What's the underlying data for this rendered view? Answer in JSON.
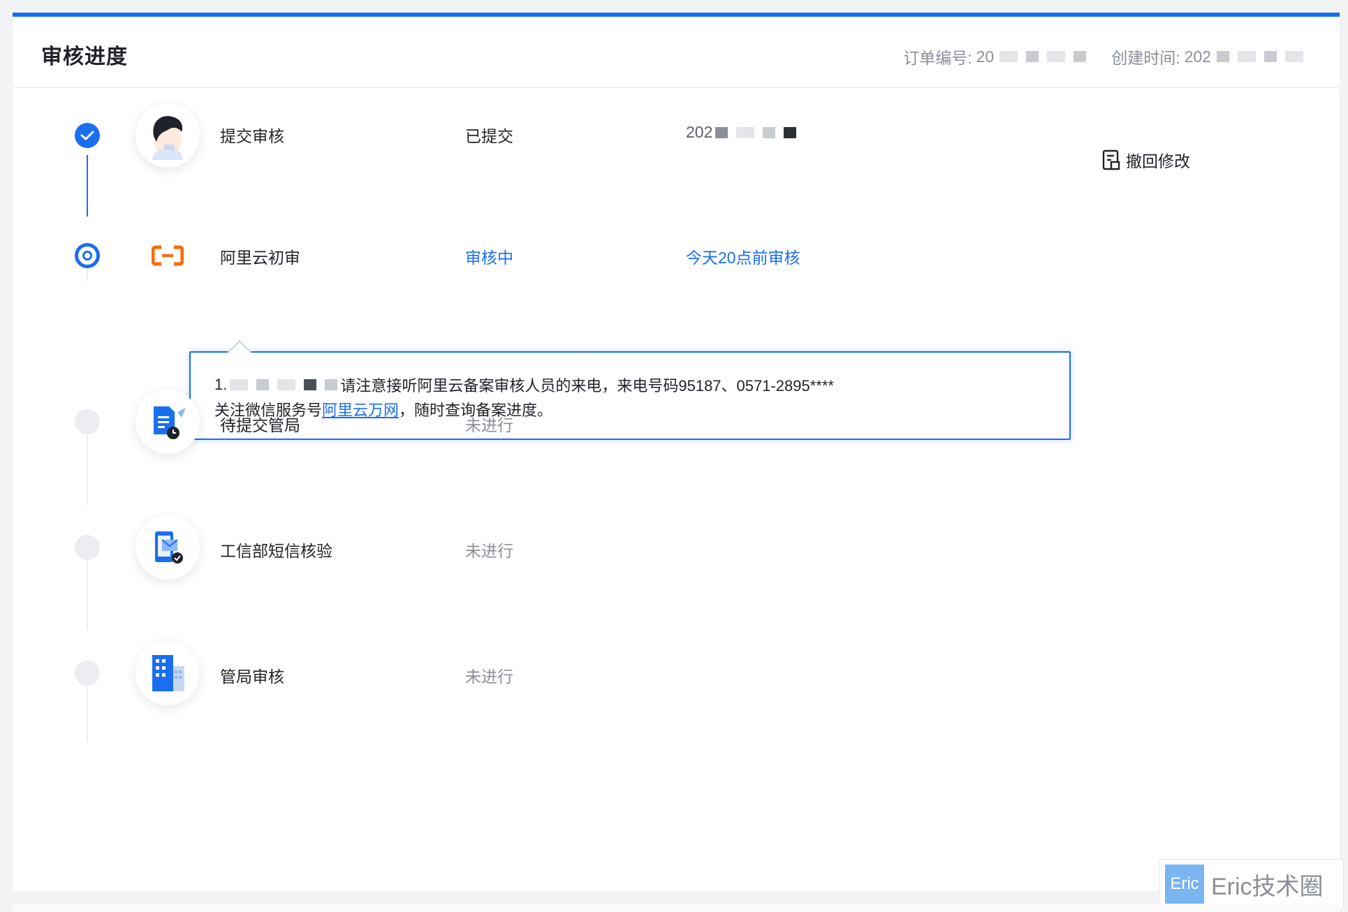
{
  "header": {
    "title": "审核进度",
    "order_label": "订单编号:",
    "order_value_visible": "20",
    "created_label": "创建时间:",
    "created_value_visible": "202"
  },
  "steps": [
    {
      "label": "提交审核",
      "status": "已提交",
      "time": "202",
      "state": "done",
      "icon": "person-avatar-icon"
    },
    {
      "label": "阿里云初审",
      "status": "审核中",
      "time": "今天20点前审核",
      "state": "active",
      "icon": "aliyun-logo-icon"
    },
    {
      "label": "待提交管局",
      "status": "未进行",
      "time": "",
      "state": "pending",
      "icon": "document-clock-icon"
    },
    {
      "label": "工信部短信核验",
      "status": "未进行",
      "time": "",
      "state": "pending",
      "icon": "sms-verify-icon"
    },
    {
      "label": "管局审核",
      "status": "未进行",
      "time": "",
      "state": "pending",
      "icon": "building-icon"
    }
  ],
  "actions": {
    "revoke_label": "撤回修改"
  },
  "popup": {
    "line1_prefix": "1.",
    "line1_text": "请注意接听阿里云备案审核人员的来电，来电号码95187、0571-2895****",
    "line2_prefix": "关注微信服务号",
    "line2_link": "阿里云万网",
    "line2_suffix": "，随时查询备案进度。"
  },
  "watermark": {
    "logo": "Eric",
    "text": "Eric技术圈"
  },
  "colors": {
    "accent": "#1a6ef0",
    "pending_gray": "#8a8f99",
    "aliyun_orange": "#ff6a00"
  }
}
